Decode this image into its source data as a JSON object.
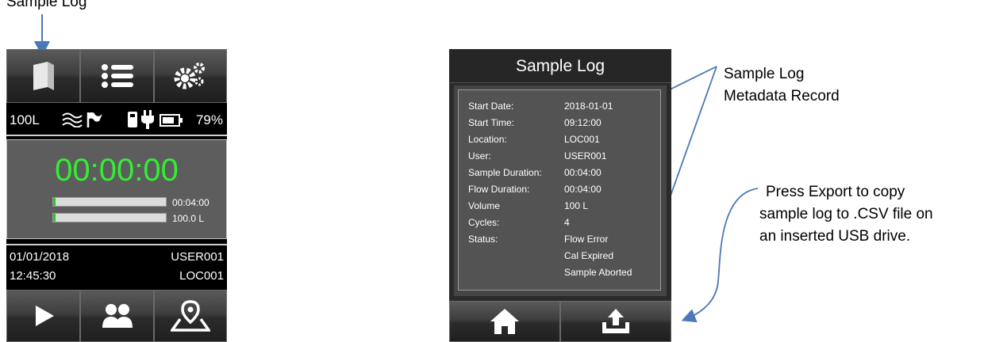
{
  "top_label": "Sample Log",
  "left_device": {
    "volume": "100L",
    "battery_percent": "79%",
    "timer": "00:00:00",
    "bars": [
      {
        "label": "00:04:00",
        "progress": 0.02
      },
      {
        "label": "100.0 L",
        "progress": 0.02
      }
    ],
    "date": "01/01/2018",
    "time": "12:45:30",
    "user": "USER001",
    "location": "LOC001",
    "icons_top": [
      "book-icon",
      "list-icon",
      "gears-icon"
    ],
    "icons_status": [
      "flow-wave-icon",
      "flag-icon",
      "usb-icon",
      "plug-icon",
      "battery-icon"
    ],
    "icons_bottom": [
      "play-icon",
      "users-icon",
      "location-map-icon"
    ]
  },
  "right_device": {
    "title": "Sample Log",
    "rows": [
      {
        "key": "Start Date:",
        "value": "2018-01-01"
      },
      {
        "key": "Start Time:",
        "value": "09:12:00"
      },
      {
        "key": "Location:",
        "value": "LOC001"
      },
      {
        "key": "User:",
        "value": "USER001"
      },
      {
        "key": "Sample Duration:",
        "value": "00:04:00"
      },
      {
        "key": "Flow Duration:",
        "value": "00:04:00"
      },
      {
        "key": "Volume",
        "value": "100 L"
      },
      {
        "key": "Cycles:",
        "value": "4"
      },
      {
        "key": "Status:",
        "value": "Flow Error"
      }
    ],
    "status_extra": [
      "Cal Expired",
      "Sample Aborted"
    ],
    "icons_bottom": [
      "home-icon",
      "export-upload-icon"
    ]
  },
  "callouts": {
    "metadata": [
      "Sample Log",
      "Metadata Record"
    ],
    "export": [
      "Press Export to copy",
      "sample log to .CSV file on",
      "an inserted USB drive."
    ]
  },
  "colors": {
    "timer": "#33ee33",
    "accent_arrow": "#4a78b8"
  }
}
